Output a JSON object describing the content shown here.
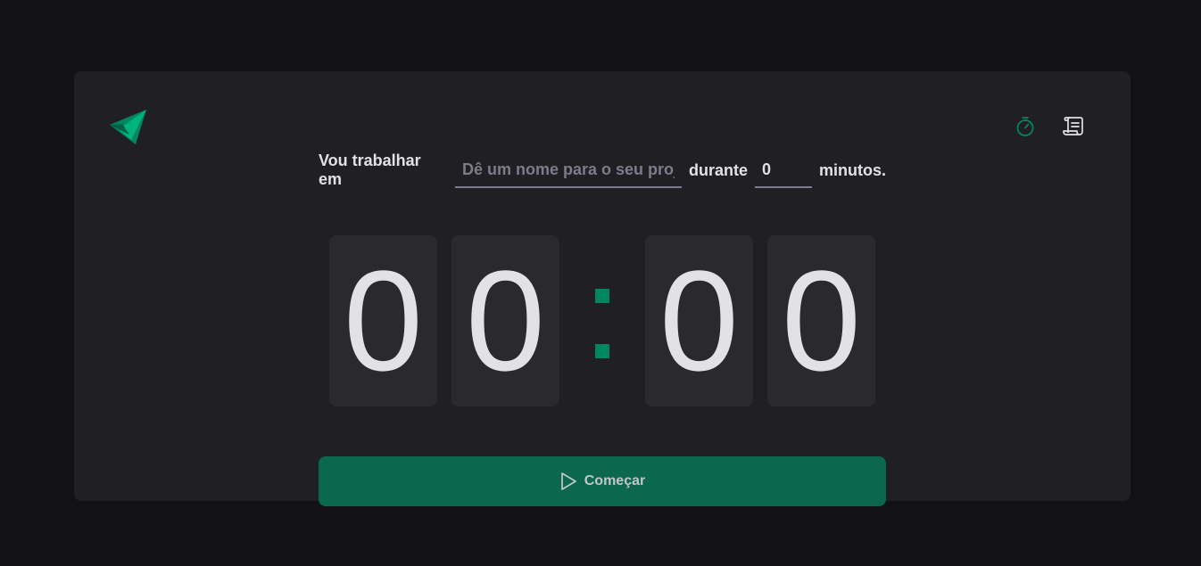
{
  "header": {
    "logo_icon": "ignite-triangle-logo-icon",
    "nav": [
      {
        "icon": "timer-icon",
        "active": true
      },
      {
        "icon": "scroll-icon",
        "active": false
      }
    ]
  },
  "form": {
    "prefix_label": "Vou trabalhar em",
    "task_placeholder": "Dê um nome para o seu projeto",
    "middle_label": "durante",
    "minutes_value": "0",
    "suffix_label": "minutos."
  },
  "countdown": {
    "minutes_tens": "0",
    "minutes_ones": "0",
    "separator": ":",
    "seconds_tens": "0",
    "seconds_ones": "0"
  },
  "start_button": {
    "label": "Começar",
    "icon": "play-icon"
  },
  "colors": {
    "background": "#121214",
    "card": "#202024",
    "digit_bg": "#29292e",
    "accent": "#00875f",
    "button": "#0b684e",
    "text": "#e1e1e6"
  }
}
